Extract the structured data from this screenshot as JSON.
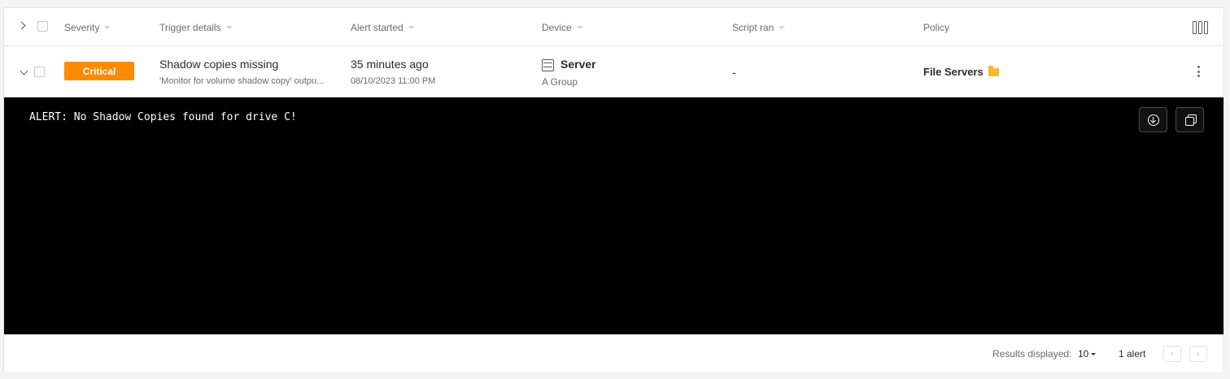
{
  "table": {
    "columns": [
      {
        "label": "Severity"
      },
      {
        "label": "Trigger details"
      },
      {
        "label": "Alert started"
      },
      {
        "label": "Device"
      },
      {
        "label": "Script ran"
      },
      {
        "label": "Policy"
      }
    ]
  },
  "row": {
    "severity": "Critical",
    "severity_color": "#ff8a00",
    "trigger_title": "Shadow copies missing",
    "trigger_detail": "'Monitor for volume shadow copy' outpu...",
    "alert_started_relative": "35 minutes ago",
    "alert_started_absolute": "08/10/2023 11:00 PM",
    "device_icon": "server-icon",
    "device_name": "Server",
    "device_group": "A Group",
    "script_ran": "-",
    "policy_name": "File Servers",
    "policy_icon": "folder-icon"
  },
  "console": {
    "output": "ALERT: No Shadow Copies found for drive C!",
    "actions": [
      {
        "name": "download",
        "icon": "download-icon"
      },
      {
        "name": "copy",
        "icon": "copy-icon"
      }
    ]
  },
  "footer": {
    "results_label": "Results displayed:",
    "results_value": "10",
    "count_label": "1 alert",
    "prev_glyph": "‹",
    "next_glyph": "›"
  }
}
